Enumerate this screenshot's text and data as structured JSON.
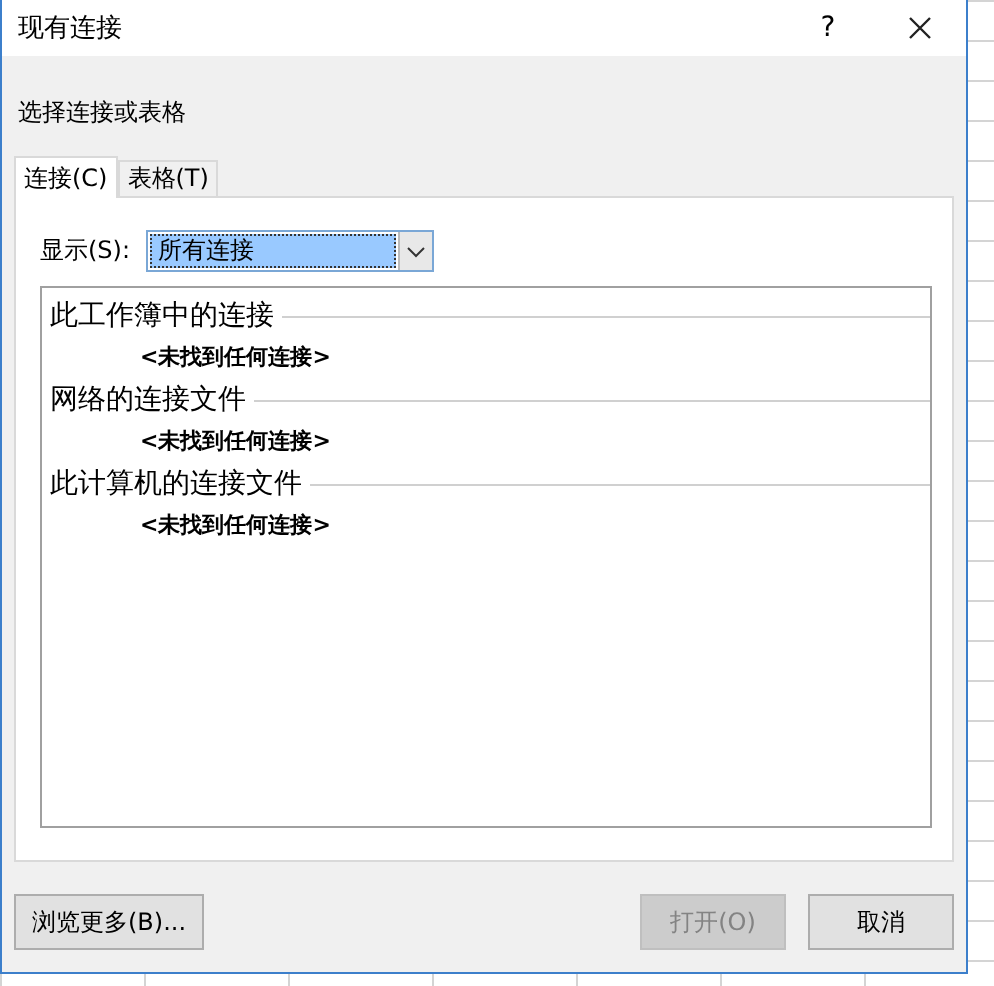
{
  "window": {
    "title": "现有连接",
    "help": "?"
  },
  "prompt": "选择连接或表格",
  "tabs": [
    {
      "label": "连接(C)",
      "selected": true
    },
    {
      "label": "表格(T)",
      "selected": false
    }
  ],
  "show": {
    "label": "显示(S):",
    "value": "所有连接"
  },
  "groups": [
    {
      "heading": "此工作簿中的连接",
      "empty": "<未找到任何连接>"
    },
    {
      "heading": "网络的连接文件",
      "empty": "<未找到任何连接>"
    },
    {
      "heading": "此计算机的连接文件",
      "empty": "<未找到任何连接>"
    }
  ],
  "buttons": [
    {
      "label": "浏览更多(B)...",
      "disabled": false,
      "kind": "left"
    },
    {
      "label": "打开(O)",
      "disabled": true,
      "kind": "right"
    },
    {
      "label": "取消",
      "disabled": false,
      "kind": "right"
    }
  ]
}
